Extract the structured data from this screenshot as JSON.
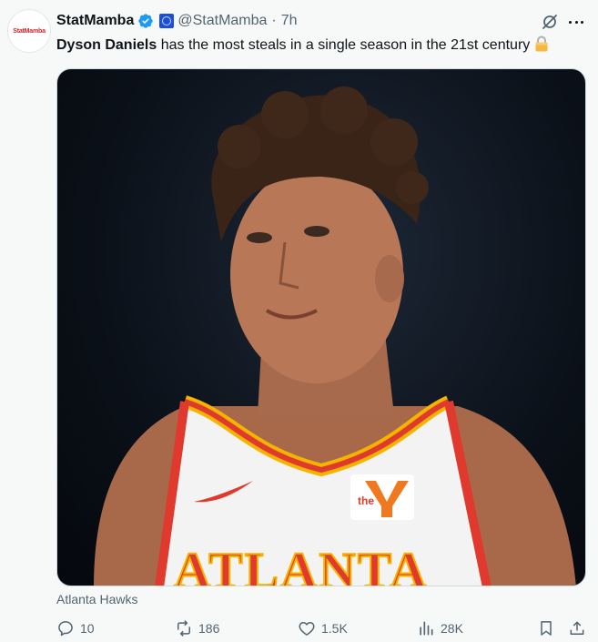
{
  "tweet": {
    "author_name": "StatMamba",
    "handle": "@StatMamba",
    "separator": "·",
    "time": "7h",
    "avatar_text": "StatMamba",
    "text_bold": "Dyson Daniels",
    "text_rest": " has the most steals in a single season in the 21st century",
    "text_emoji": "lock-icon",
    "media_caption": "Atlanta Hawks",
    "jersey_text": "ATLANTA",
    "jersey_patch_text": "the"
  },
  "actions": {
    "replies": "10",
    "reposts": "186",
    "likes": "1.5K",
    "views": "28K"
  },
  "colors": {
    "verified": "#1d9bf0",
    "text_secondary": "#536471",
    "jersey_red": "#e03a2e",
    "jersey_gold": "#f4b400"
  }
}
